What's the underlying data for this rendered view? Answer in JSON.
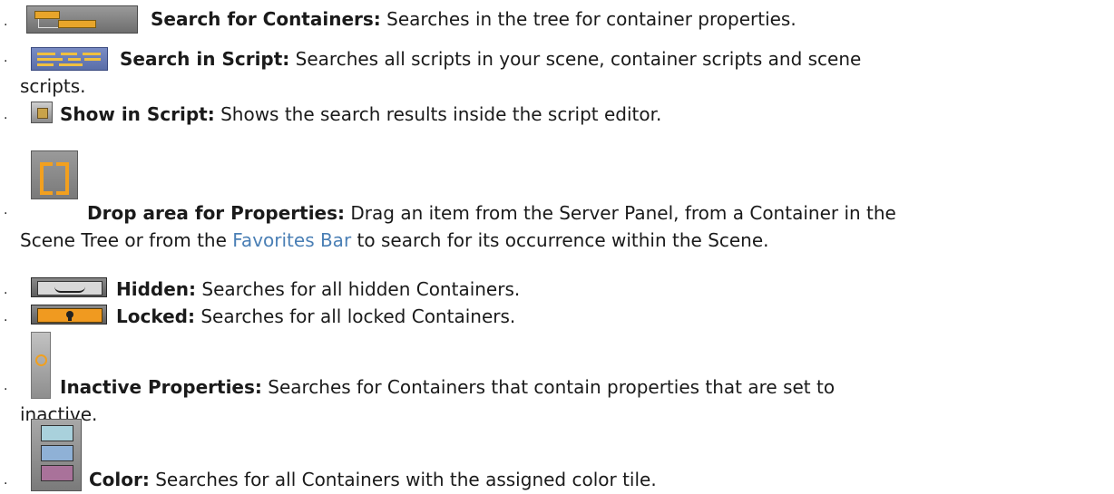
{
  "items": [
    {
      "icon": "search-containers-icon",
      "term": "Search for Containers:",
      "text": " Searches in the tree for container properties."
    },
    {
      "icon": "search-in-script-icon",
      "term": "Search in Script:",
      "text": " Searches all scripts in your scene, container scripts and scene",
      "continuation": "scripts."
    },
    {
      "icon": "show-in-script-icon",
      "term": "Show in Script:",
      "text": " Shows the search results inside the script editor."
    },
    {
      "icon": "drop-area-icon",
      "term": "Drop area for Properties:",
      "text": " Drag an item from the Server Panel, from a Container in the",
      "continuation_before": "Scene Tree or from the ",
      "link": "Favorites Bar",
      "continuation_after": " to search for its occurrence within the Scene."
    },
    {
      "icon": "hidden-icon",
      "term": "Hidden:",
      "text": " Searches for all hidden Containers."
    },
    {
      "icon": "locked-icon",
      "term": "Locked:",
      "text": " Searches for all locked Containers."
    },
    {
      "icon": "inactive-properties-icon",
      "term": "Inactive Properties:",
      "text": " Searches for Containers that contain properties that are set to",
      "continuation": "inactive."
    },
    {
      "icon": "color-icon",
      "term": "Color:",
      "text": " Searches for all Containers with the assigned color tile."
    }
  ],
  "bullet": "·",
  "colors": {
    "link": "#4a7fb5",
    "accent_orange": "#f2a01f",
    "color_tiles": [
      "#a9d1dc",
      "#8fb1d6",
      "#a9729a"
    ]
  }
}
